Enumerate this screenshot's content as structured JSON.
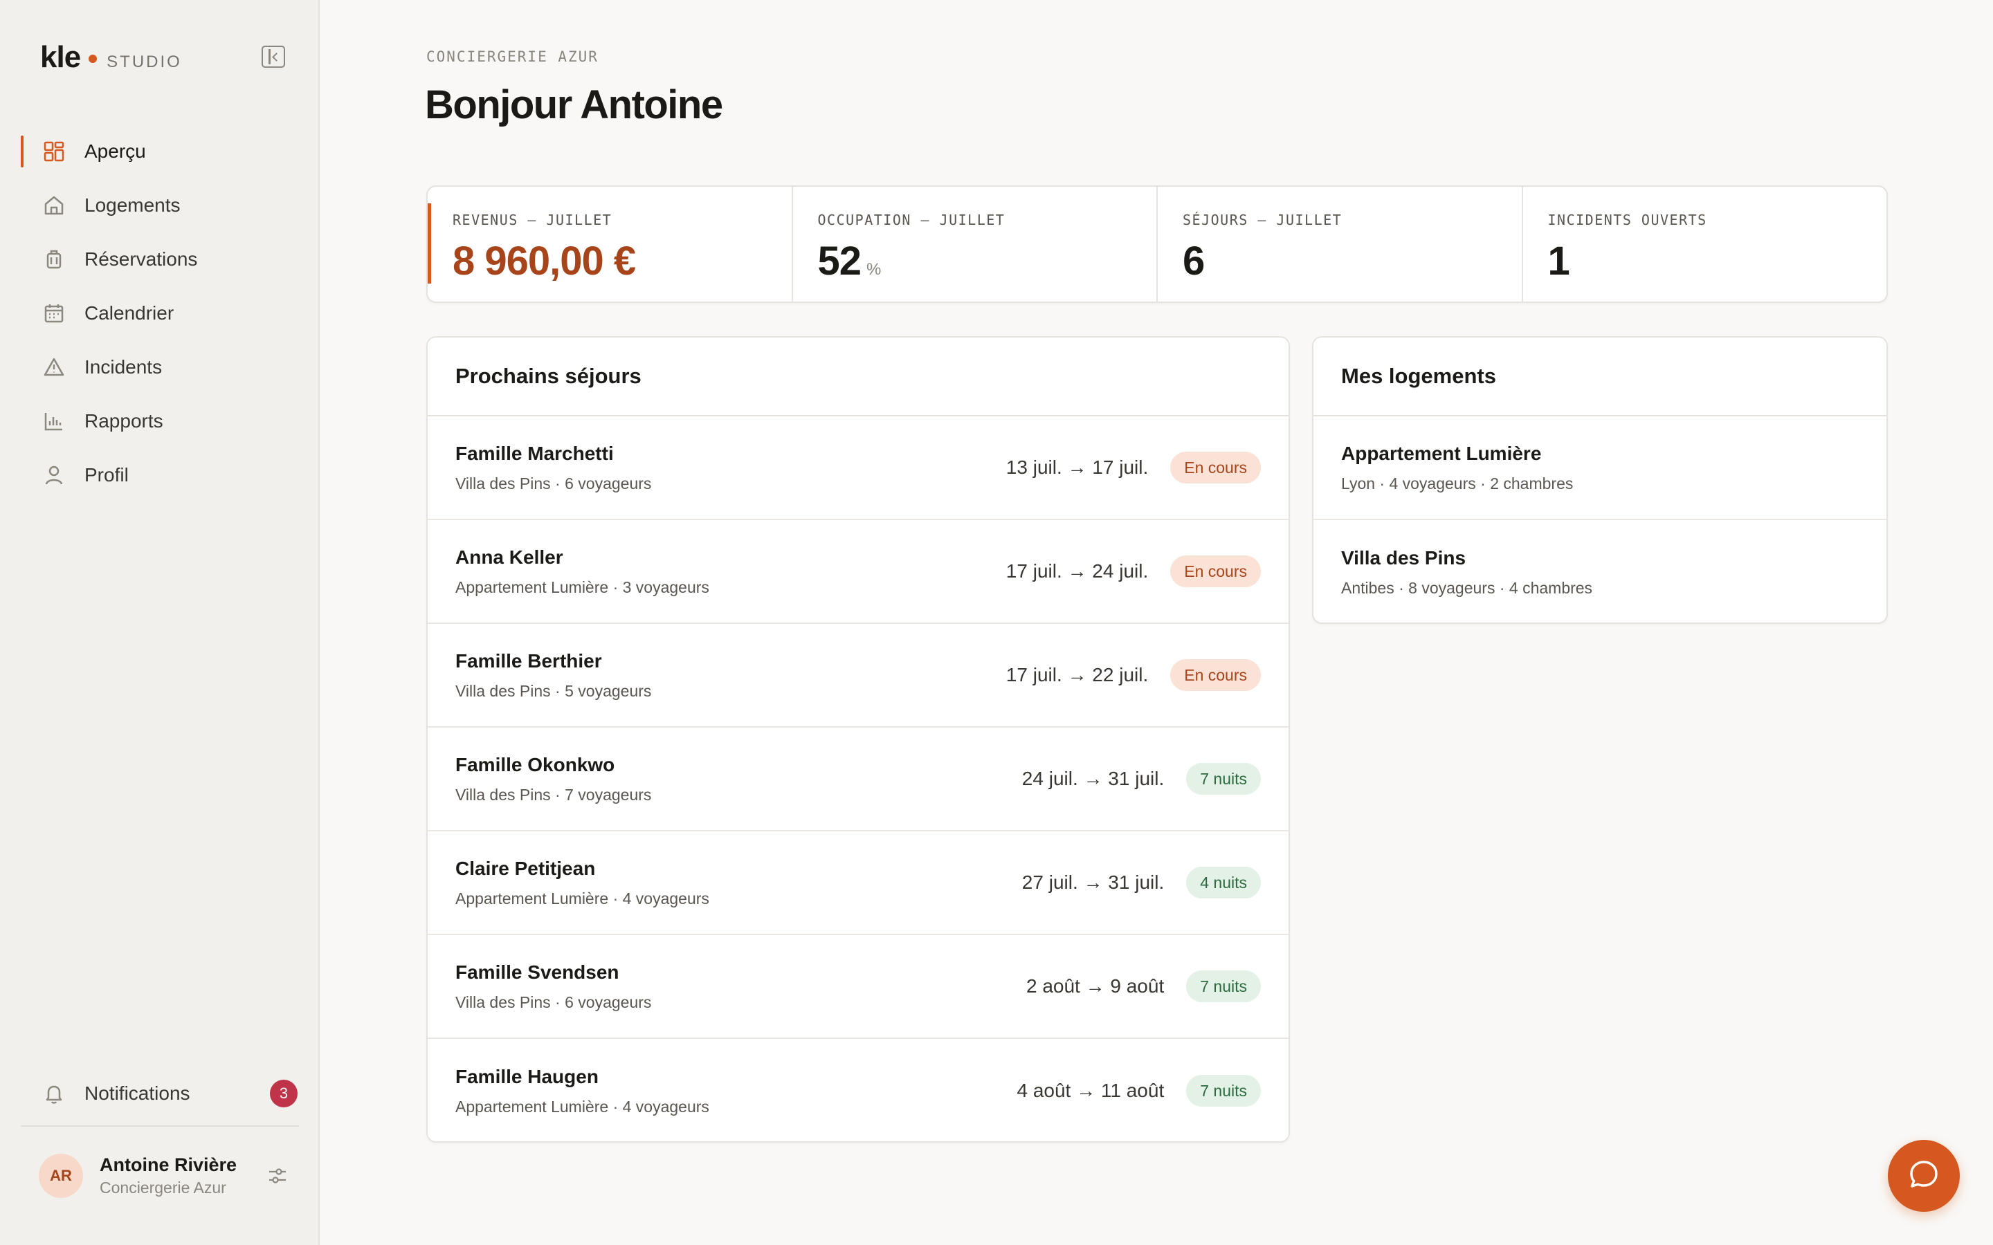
{
  "brand": {
    "name": "kle",
    "product": "STUDIO",
    "accent": "#d4581f"
  },
  "sidebar": {
    "items": [
      {
        "label": "Aperçu",
        "icon": "grid-icon",
        "active": true
      },
      {
        "label": "Logements",
        "icon": "home-icon"
      },
      {
        "label": "Réservations",
        "icon": "luggage-icon"
      },
      {
        "label": "Calendrier",
        "icon": "calendar-icon"
      },
      {
        "label": "Incidents",
        "icon": "alert-triangle-icon"
      },
      {
        "label": "Rapports",
        "icon": "bar-chart-icon"
      },
      {
        "label": "Profil",
        "icon": "user-icon"
      }
    ],
    "notifications": {
      "label": "Notifications",
      "count": "3",
      "icon": "bell-icon"
    },
    "user": {
      "initials": "AR",
      "name": "Antoine Rivière",
      "org": "Conciergerie Azur",
      "icon": "sliders-icon"
    }
  },
  "header": {
    "eyebrow": "CONCIERGERIE AZUR",
    "title": "Bonjour Antoine"
  },
  "stats": [
    {
      "label": "REVENUS — JUILLET",
      "value": "8 960,00 €",
      "unit": ""
    },
    {
      "label": "OCCUPATION — JUILLET",
      "value": "52",
      "unit": "%"
    },
    {
      "label": "SÉJOURS — JUILLET",
      "value": "6",
      "unit": ""
    },
    {
      "label": "INCIDENTS OUVERTS",
      "value": "1",
      "unit": ""
    }
  ],
  "upcoming": {
    "title": "Prochains séjours",
    "rows": [
      {
        "guest": "Famille Marchetti",
        "detail": "Villa des Pins · 6 voyageurs",
        "dates": "13 juil. → 17 juil.",
        "status": "En cours",
        "kind": "current"
      },
      {
        "guest": "Anna Keller",
        "detail": "Appartement Lumière · 3 voyageurs",
        "dates": "17 juil. → 24 juil.",
        "status": "En cours",
        "kind": "current"
      },
      {
        "guest": "Famille Berthier",
        "detail": "Villa des Pins · 5 voyageurs",
        "dates": "17 juil. → 22 juil.",
        "status": "En cours",
        "kind": "current"
      },
      {
        "guest": "Famille Okonkwo",
        "detail": "Villa des Pins · 7 voyageurs",
        "dates": "24 juil. → 31 juil.",
        "status": "7 nuits",
        "kind": "nights"
      },
      {
        "guest": "Claire Petitjean",
        "detail": "Appartement Lumière · 4 voyageurs",
        "dates": "27 juil. → 31 juil.",
        "status": "4 nuits",
        "kind": "nights"
      },
      {
        "guest": "Famille Svendsen",
        "detail": "Villa des Pins · 6 voyageurs",
        "dates": "2 août → 9 août",
        "status": "7 nuits",
        "kind": "nights"
      },
      {
        "guest": "Famille Haugen",
        "detail": "Appartement Lumière · 4 voyageurs",
        "dates": "4 août → 11 août",
        "status": "7 nuits",
        "kind": "nights"
      }
    ]
  },
  "homes": {
    "title": "Mes logements",
    "rows": [
      {
        "name": "Appartement Lumière",
        "detail": "Lyon · 4 voyageurs · 2 chambres"
      },
      {
        "name": "Villa des Pins",
        "detail": "Antibes · 8 voyageurs · 4 chambres"
      }
    ]
  },
  "chat": {
    "icon": "chat-bubble-icon"
  }
}
